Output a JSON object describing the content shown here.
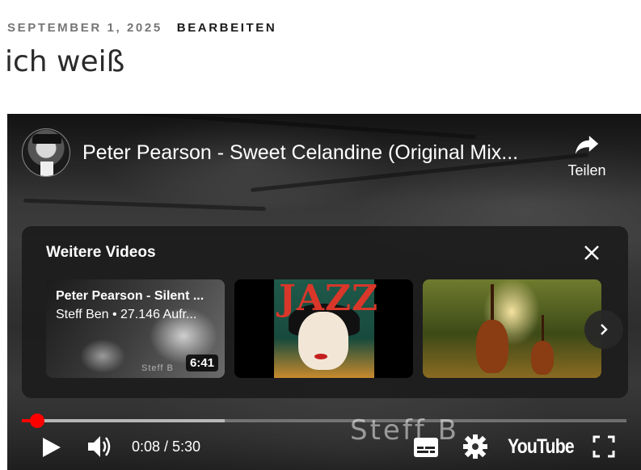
{
  "post": {
    "date": "SEPTEMBER 1, 2025",
    "edit_link": "BEARBEITEN",
    "title": "ich weiß"
  },
  "player": {
    "video_title": "Peter Pearson - Sweet Celandine (Original Mix...",
    "share_label": "Teilen",
    "channel_avatar_icon": "channel-avatar",
    "more_videos": {
      "heading": "Weitere Videos",
      "items": [
        {
          "title": "Peter Pearson - Silent ...",
          "subtitle": "Steff Ben • 27.146 Aufr...",
          "duration": "6:41",
          "watermark": "Steff B"
        },
        {
          "poster_word": "JAZZ"
        },
        {}
      ]
    },
    "watermark": "Steff B",
    "progress": {
      "played_fraction": 0.025,
      "buffered_fraction": 0.335
    },
    "time_current": "0:08",
    "time_separator": "/",
    "time_total": "5:30",
    "time_display": "0:08 / 5:30",
    "logo_text": "YouTube",
    "colors": {
      "accent": "#ff0000",
      "panel": "#1c1c1c"
    }
  }
}
